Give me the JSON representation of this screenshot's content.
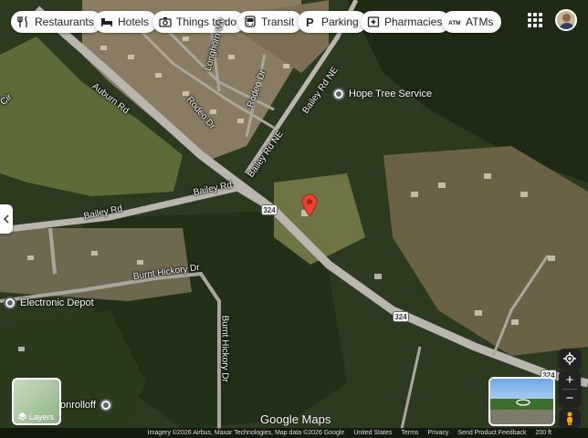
{
  "toolbar": {
    "chips": [
      {
        "label": "Restaurants",
        "icon": "fork-knife-icon"
      },
      {
        "label": "Hotels",
        "icon": "bed-icon"
      },
      {
        "label": "Things to do",
        "icon": "camera-icon"
      },
      {
        "label": "Transit",
        "icon": "bus-icon"
      },
      {
        "label": "Parking",
        "icon": "parking-icon"
      },
      {
        "label": "Pharmacies",
        "icon": "pharmacy-icon"
      },
      {
        "label": "ATMs",
        "icon": "atm-icon"
      }
    ]
  },
  "roads": {
    "auburn": "Auburn Rd",
    "bailey_main": "Bailey Rd",
    "bailey_west": "Bailey Rd",
    "bailey_ne_1": "Bailey Rd NE",
    "bailey_ne_2": "Bailey Rd NE",
    "burnt_hickory_h": "Burnt Hickory Dr",
    "burnt_hickory_v": "Burnt Hickory Dr",
    "longhorn": "Longhorn Wy",
    "rodeo": "Rodeo Dr",
    "rodeo2": "Rodeo Dr",
    "corner_left": "Cir"
  },
  "route_shields": [
    "324",
    "324",
    "324"
  ],
  "pois": {
    "hope_tree": "Hope Tree Service",
    "electronic_depot": "Electronic Depot",
    "onrolloff": "onrolloff"
  },
  "layers_label": "Layers",
  "google_logo": "Google Maps",
  "footer": {
    "imagery": "Imagery ©2026 Airbus, Maxar Technologies, Map data ©2026 Google",
    "united_states": "United States",
    "terms": "Terms",
    "privacy": "Privacy",
    "feedback": "Send Product Feedback",
    "scale": "200 ft"
  },
  "colors": {
    "pin": "#ea4335",
    "road": "#b9b6ae",
    "forest": "#243318",
    "field": "#5c6b38"
  }
}
